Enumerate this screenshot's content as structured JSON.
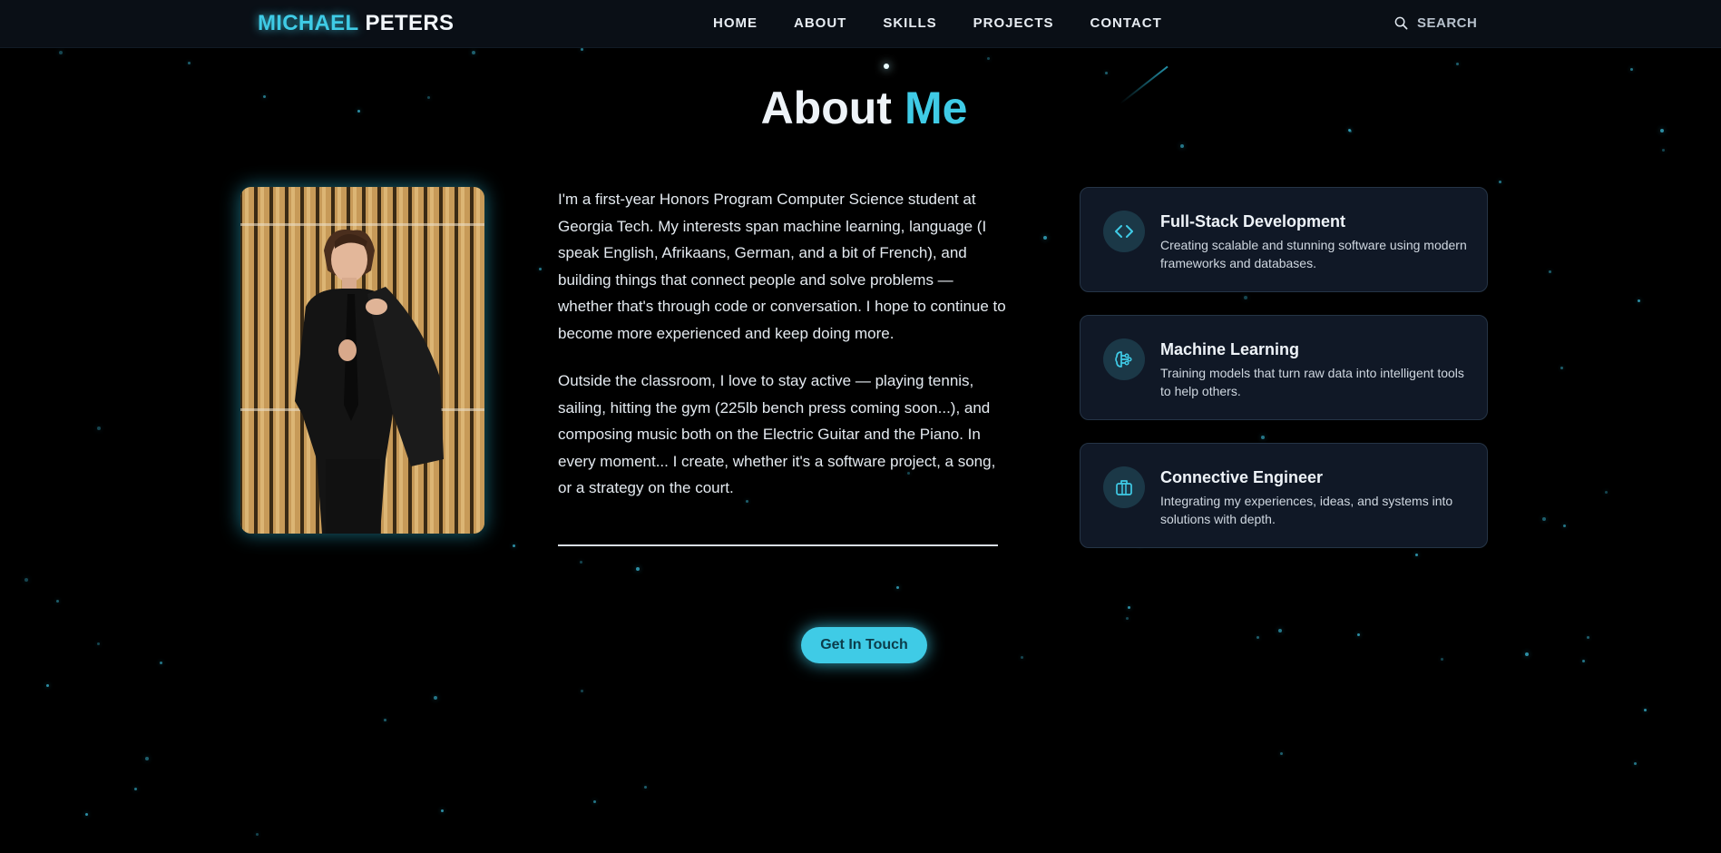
{
  "nav": {
    "logo_first": "MICHAEL",
    "logo_last": "PETERS",
    "links": [
      "HOME",
      "ABOUT",
      "SKILLS",
      "PROJECTS",
      "CONTACT"
    ],
    "search_label": "SEARCH"
  },
  "section": {
    "title_main": "About",
    "title_accent": "Me"
  },
  "bio": {
    "paragraph1": "I'm a first-year Honors Program Computer Science student at Georgia Tech. My interests span machine learning, language (I speak English, Afrikaans, German, and a bit of French), and building things that connect people and solve problems — whether that's through code or conversation. I hope to continue to become more experienced and keep doing more.",
    "paragraph2": "Outside the classroom, I love to stay active — playing tennis, sailing, hitting the gym (225lb bench press coming soon...), and composing music both on the Electric Guitar and the Piano. In every moment... I create, whether it's a software project, a song, or a strategy on the court."
  },
  "cta": {
    "label": "Get In Touch"
  },
  "cards": [
    {
      "icon": "code-icon",
      "title": "Full-Stack Development",
      "description": "Creating scalable and stunning software using modern frameworks and databases."
    },
    {
      "icon": "brain-icon",
      "title": "Machine Learning",
      "description": "Training models that turn raw data into intelligent tools to help others."
    },
    {
      "icon": "briefcase-icon",
      "title": "Connective Engineer",
      "description": "Integrating my experiences, ideas, and systems into solutions with depth."
    }
  ],
  "colors": {
    "accent": "#3fcbe6",
    "background": "#000000",
    "nav_background": "#0a0f16",
    "card_background": "#101826",
    "card_border": "#253446"
  }
}
